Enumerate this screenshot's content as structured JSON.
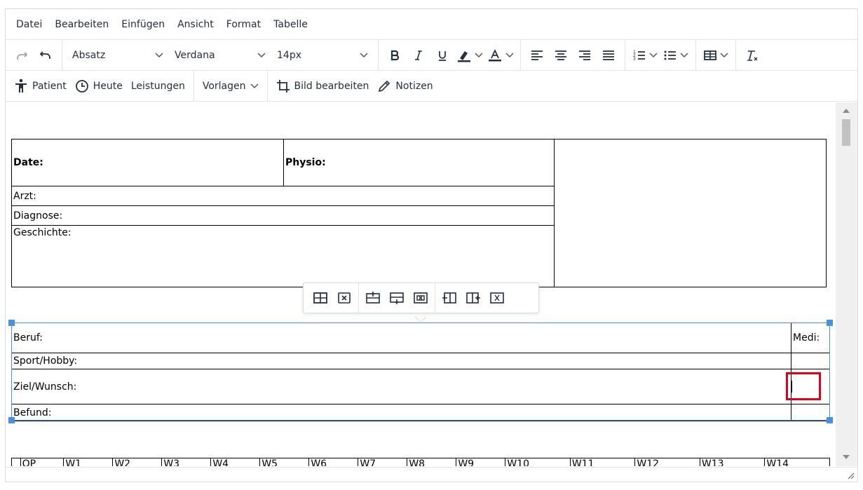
{
  "menubar": {
    "items": [
      "Datei",
      "Bearbeiten",
      "Einfügen",
      "Ansicht",
      "Format",
      "Tabelle"
    ]
  },
  "toolbar1": {
    "block_format": "Absatz",
    "font_family": "Verdana",
    "font_size": "14px"
  },
  "toolbar2": {
    "patient": "Patient",
    "heute": "Heute",
    "leistungen": "Leistungen",
    "vorlagen": "Vorlagen",
    "bild_bearbeiten": "Bild bearbeiten",
    "notizen": "Notizen"
  },
  "document": {
    "table1": {
      "date": "Date:",
      "physio": "Physio:",
      "arzt": "Arzt:",
      "diagnose": "Diagnose:",
      "geschichte": "Geschichte:"
    },
    "table2": {
      "beruf": "Beruf:",
      "medi": "Medi:",
      "sport": "Sport/Hobby:",
      "ziel": "Ziel/Wunsch:",
      "befund": "Befund:"
    },
    "table3": {
      "headers": [
        "",
        "OP",
        "W1",
        "W2",
        "W3",
        "W4",
        "W5",
        "W6",
        "W7",
        "W8",
        "W9",
        "W10",
        "W11",
        "W12",
        "W13",
        "W14"
      ]
    }
  },
  "colors": {
    "accent": "#4a90e2",
    "highlight": "#e0001b"
  }
}
